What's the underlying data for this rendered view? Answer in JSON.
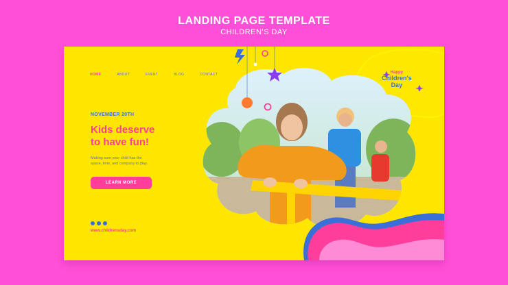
{
  "header": {
    "title": "LANDING PAGE TEMPLATE",
    "subtitle": "CHILDREN'S DAY"
  },
  "nav": {
    "items": [
      "HOME",
      "ABOUT",
      "EVENT",
      "BLOG",
      "CONTACT"
    ],
    "active": "HOME"
  },
  "hero": {
    "date": "NOVEMBER 20TH",
    "headline_line1": "Kids deserve",
    "headline_line2": "to have fun!",
    "body_line1": "Making sure your child has the",
    "body_line2": "space, time, and company to play.",
    "button": "LEARN MORE",
    "website": "www.childrensday.com"
  },
  "badge": {
    "line1": "Happy",
    "line2": "Children's",
    "line3": "Day"
  },
  "icons": [
    "instagram-icon",
    "facebook-icon",
    "twitter-icon",
    "lightning-icon",
    "star-icon",
    "ring-icon",
    "sparkle-icon"
  ],
  "colors": {
    "background": "#ff4fd8",
    "card": "#ffe600",
    "accent_pink": "#ff3d9a",
    "accent_blue": "#3a6fd8",
    "purple": "#8a3df0"
  }
}
